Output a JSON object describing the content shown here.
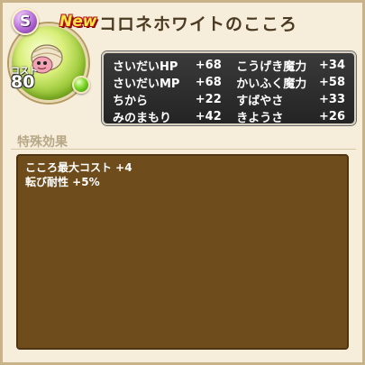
{
  "header": {
    "rank": "S",
    "new_label": "New",
    "title": "コロネホワイトのこころ"
  },
  "portrait": {
    "cost_label": "コスト",
    "cost_value": "80",
    "monster_icon": "corone-white-monster-icon",
    "orb_color": "#a9d640",
    "gem_color": "#7fd92a"
  },
  "stats": [
    {
      "left_name": "さいだいHP",
      "left_value": "+68",
      "right_name": "こうげき魔力",
      "right_value": "+34"
    },
    {
      "left_name": "さいだいMP",
      "left_value": "+68",
      "right_name": "かいふく魔力",
      "right_value": "+58"
    },
    {
      "left_name": "ちから",
      "left_value": "+22",
      "right_name": "すばやさ",
      "right_value": "+33"
    },
    {
      "left_name": "みのまもり",
      "left_value": "+42",
      "right_name": "きようさ",
      "right_value": "+26"
    }
  ],
  "special": {
    "label": "特殊効果",
    "effects": [
      "こころ最大コスト +4",
      "転び耐性 +5%"
    ]
  }
}
